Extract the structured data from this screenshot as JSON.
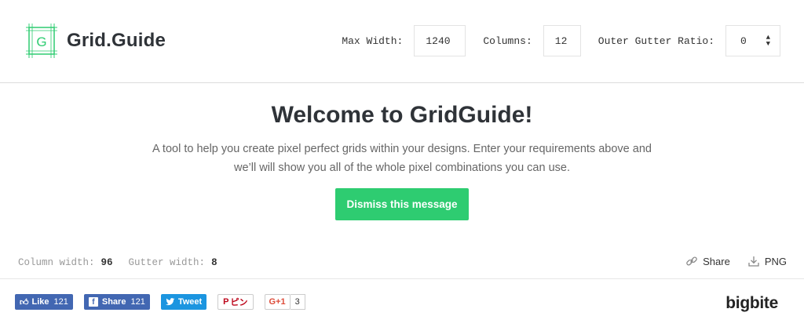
{
  "brand": {
    "name": "Grid.Guide",
    "logo_letter": "G",
    "accent": "#2ecc71"
  },
  "controls": {
    "max_width_label": "Max Width:",
    "max_width_value": "1240",
    "columns_label": "Columns:",
    "columns_value": "12",
    "outer_gutter_label": "Outer Gutter Ratio:",
    "outer_gutter_value": "0"
  },
  "welcome": {
    "title": "Welcome to GridGuide!",
    "body": "A tool to help you create pixel perfect grids within your designs. Enter your requirements above and we’ll will show you all of the whole pixel combinations you can use.",
    "dismiss_label": "Dismiss this message"
  },
  "info": {
    "column_width_label": "Column width:",
    "column_width_value": "96",
    "gutter_width_label": "Gutter width:",
    "gutter_width_value": "8",
    "share_label": "Share",
    "png_label": "PNG"
  },
  "social": {
    "like_label": "Like",
    "like_count": "121",
    "share_label": "Share",
    "share_count": "121",
    "tweet_label": "Tweet",
    "pin_label": "ピン",
    "gplus_label": "G+1",
    "gplus_count": "3"
  },
  "footer": {
    "credit": "bigbite"
  }
}
